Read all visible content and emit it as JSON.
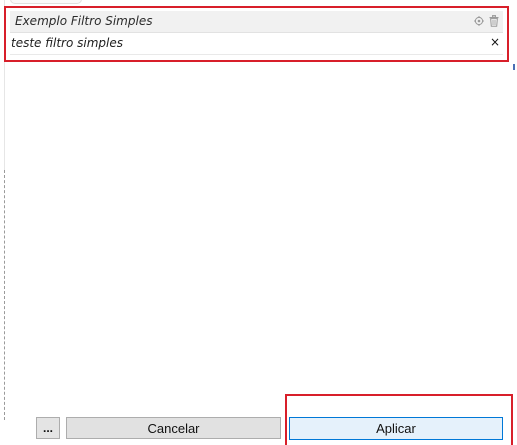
{
  "filter": {
    "title": "Exemplo Filtro Simples",
    "value": "teste filtro simples",
    "clear_glyph": "×",
    "icons": {
      "target": "crosshair-icon",
      "trash": "trash-icon"
    }
  },
  "footer": {
    "more_label": "...",
    "cancel_label": "Cancelar",
    "apply_label": "Aplicar"
  },
  "colors": {
    "highlight": "#d81f2a",
    "apply_border": "#0078d7",
    "apply_background": "#e5f1fb"
  }
}
